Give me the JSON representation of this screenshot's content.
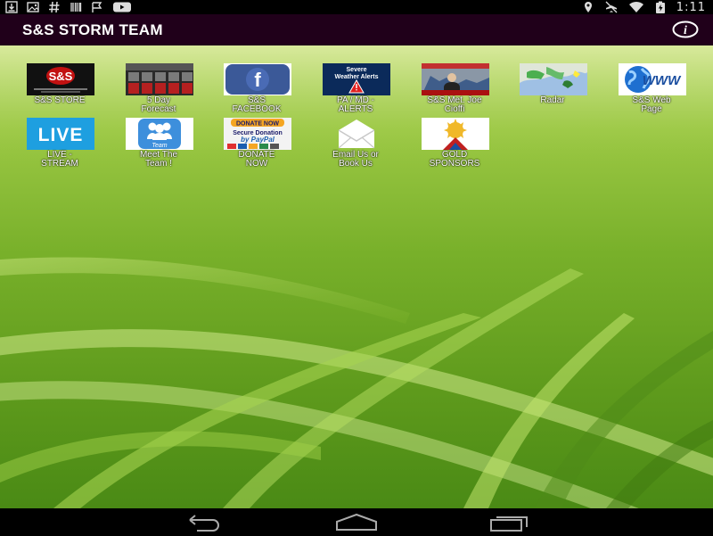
{
  "status_bar": {
    "time": "1:11",
    "left_icons": [
      "download-icon",
      "photo-icon",
      "hash-icon",
      "barcode-icon",
      "flag-icon",
      "youtube-icon"
    ],
    "right_icons": [
      "location-icon",
      "airplane-mode-icon",
      "wifi-icon",
      "battery-icon"
    ]
  },
  "app_bar": {
    "title": "S&S STORM TEAM",
    "info_icon": "info-icon"
  },
  "tiles": [
    {
      "line1": "S&S STORE",
      "line2": "",
      "thumb": "s-and-s-logo",
      "thumb_text": "S&S"
    },
    {
      "line1": "5 Day",
      "line2": "Forecast",
      "thumb": "forecast-thumbnail",
      "thumb_text": ""
    },
    {
      "line1": "S&S",
      "line2": "FACEBOOK",
      "thumb": "facebook-icon",
      "thumb_text": "f"
    },
    {
      "line1": "PA / MD -",
      "line2": "ALERTS",
      "thumb": "severe-weather-alerts",
      "thumb_text": "Severe Weather Alerts"
    },
    {
      "line1": "S&S Met. Joe",
      "line2": "Cioffi",
      "thumb": "meteorologist-photo",
      "thumb_text": ""
    },
    {
      "line1": "Radar",
      "line2": "",
      "thumb": "radar-map",
      "thumb_text": ""
    },
    {
      "line1": "S&S Web",
      "line2": "Page",
      "thumb": "www-globe",
      "thumb_text": "WWW"
    },
    {
      "line1": "LIVE -",
      "line2": "STREAM",
      "thumb": "live-badge",
      "thumb_text": "LIVE"
    },
    {
      "line1": "Meet The",
      "line2": "Team !",
      "thumb": "team-icon",
      "thumb_text": "Team"
    },
    {
      "line1": "DONATE",
      "line2": "NOW",
      "thumb": "donate-paypal",
      "thumb_text": "DONATE NOW"
    },
    {
      "line1": "Email Us or",
      "line2": "Book Us",
      "thumb": "envelope-icon",
      "thumb_text": ""
    },
    {
      "line1": "GOLD",
      "line2": "SPONSORS",
      "thumb": "gold-sun-badge",
      "thumb_text": ""
    }
  ],
  "nav_bar": {
    "back_icon": "back-icon",
    "home_icon": "home-icon",
    "recents_icon": "recents-icon"
  },
  "colors": {
    "app_bar": "#20001a",
    "label_text": "#ffffff",
    "facebook": "#3b5998",
    "live": "#1e9fe0"
  }
}
